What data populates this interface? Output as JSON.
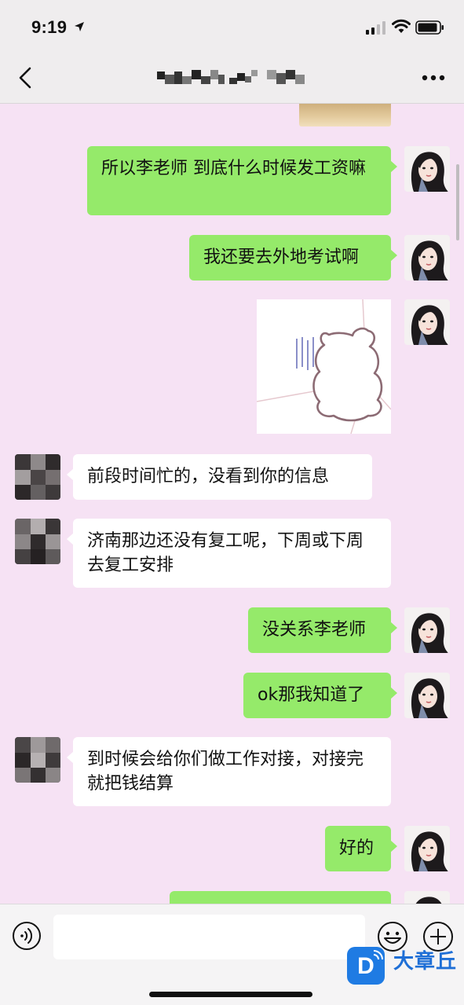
{
  "status_bar": {
    "time": "9:19",
    "icons": [
      "location-arrow-icon",
      "cellular-signal-icon",
      "wifi-icon",
      "battery-icon"
    ]
  },
  "header": {
    "back_icon": "chevron-left-icon",
    "title_obscured": true,
    "more_icon": "more-dots-icon"
  },
  "colors": {
    "chat_background": "#f6e2f4",
    "sent_bubble": "#95ea6a",
    "received_bubble": "#ffffff",
    "header_background": "#efedee",
    "watermark": "#1f6fd6"
  },
  "messages": [
    {
      "side": "me",
      "type": "image",
      "partial": true
    },
    {
      "side": "me",
      "type": "text",
      "text": "所以李老师 到底什么时候发工资嘛"
    },
    {
      "side": "me",
      "type": "text",
      "text": "我还要去外地考试啊"
    },
    {
      "side": "me",
      "type": "sticker",
      "sticker": "bear-outline-sticker"
    },
    {
      "side": "other",
      "type": "text",
      "text": "前段时间忙的，没看到你的信息"
    },
    {
      "side": "other",
      "type": "text",
      "text": "济南那边还没有复工呢，下周或下周去复工安排"
    },
    {
      "side": "me",
      "type": "text",
      "text": "没关系李老师"
    },
    {
      "side": "me",
      "type": "text",
      "text": "ok那我知道了"
    },
    {
      "side": "other",
      "type": "text",
      "text": "到时候会给你们做工作对接，对接完就把钱结算"
    },
    {
      "side": "me",
      "type": "text",
      "text": "好的"
    },
    {
      "side": "me",
      "type": "text",
      "text": "",
      "partial": true
    }
  ],
  "input_bar": {
    "voice_icon": "voice-input-icon",
    "text_value": "",
    "emoji_icon": "emoji-icon",
    "plus_icon": "plus-icon"
  },
  "watermark": {
    "logo_letter": "D",
    "text": "大章丘"
  }
}
